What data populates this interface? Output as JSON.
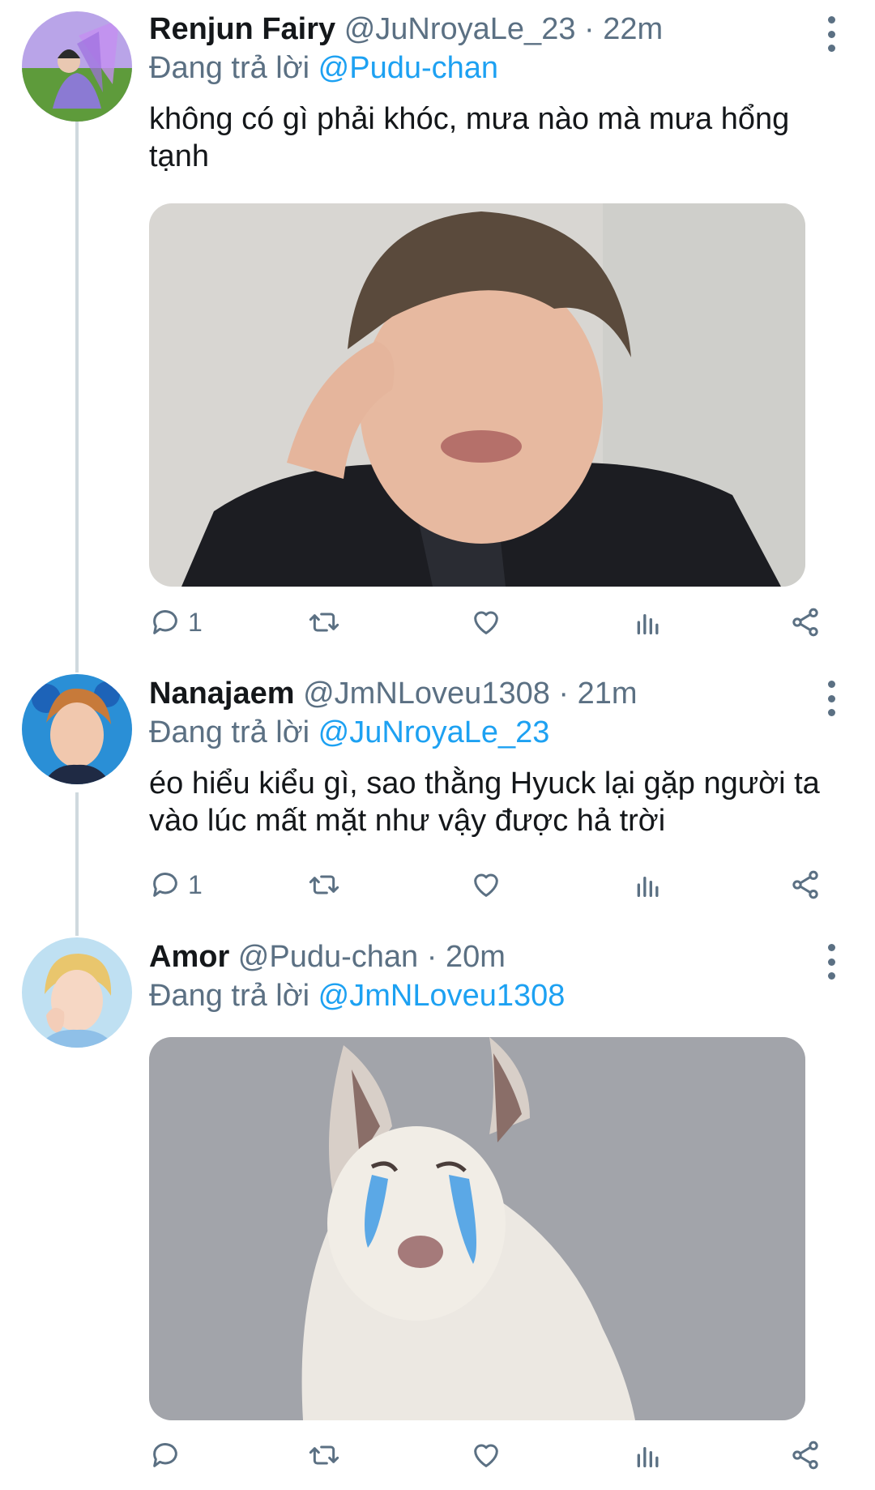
{
  "tweets": [
    {
      "name": "Renjun Fairy",
      "handle": "@JuNroyaLe_23",
      "time": "22m",
      "reply_prefix": "Đang trả lời",
      "reply_to": "@Pudu-chan",
      "text": "không có gì phải khóc, mưa nào mà mưa hổng tạnh",
      "reply_count": "1",
      "has_media": true
    },
    {
      "name": "Nanajaem",
      "handle": "@JmNLoveu1308",
      "time": "21m",
      "reply_prefix": "Đang trả lời",
      "reply_to": "@JuNroyaLe_23",
      "text": "éo hiểu kiểu gì, sao thằng Hyuck lại gặp người ta vào lúc mất mặt như vậy được hả trời",
      "reply_count": "1",
      "has_media": false
    },
    {
      "name": "Amor",
      "handle": "@Pudu-chan",
      "time": "20m",
      "reply_prefix": "Đang trả lời",
      "reply_to": "@JmNLoveu1308",
      "text": "",
      "reply_count": "",
      "has_media": true
    }
  ],
  "colors": {
    "accent": "#1da1f2",
    "secondary_text": "#5b7083",
    "primary_text": "#14171a",
    "thread_line": "#cfd9de"
  },
  "icons": [
    "reply-icon",
    "retweet-icon",
    "like-icon",
    "analytics-icon",
    "share-icon",
    "more-icon"
  ]
}
